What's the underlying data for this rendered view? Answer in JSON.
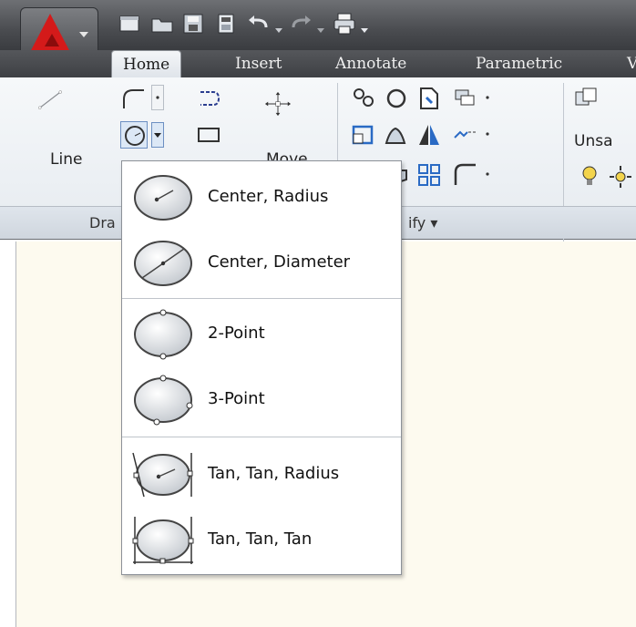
{
  "tabs": [
    {
      "label": "Home"
    },
    {
      "label": "Insert"
    },
    {
      "label": "Annotate"
    },
    {
      "label": "Parametric"
    },
    {
      "label": "V"
    }
  ],
  "ribbon": {
    "line_label": "Line",
    "move_label": "Move",
    "layer_text": "Unsa",
    "draw_panel_title": "Dra",
    "modify_panel_title": "ify ▾"
  },
  "circle_menu": {
    "items": [
      {
        "label": "Center, Radius",
        "icon": "circle-center-radius-icon"
      },
      {
        "label": "Center, Diameter",
        "icon": "circle-center-diameter-icon"
      },
      {
        "label": "2-Point",
        "icon": "circle-2-point-icon"
      },
      {
        "label": "3-Point",
        "icon": "circle-3-point-icon"
      },
      {
        "label": "Tan, Tan, Radius",
        "icon": "circle-tan-tan-radius-icon"
      },
      {
        "label": "Tan, Tan, Tan",
        "icon": "circle-tan-tan-tan-icon"
      }
    ]
  },
  "colors": {
    "title_bar": "#4a4c50",
    "ribbon_bg": "#eef2f6",
    "drawing_bg": "#fdfaef",
    "logo_red": "#d41a1a"
  }
}
